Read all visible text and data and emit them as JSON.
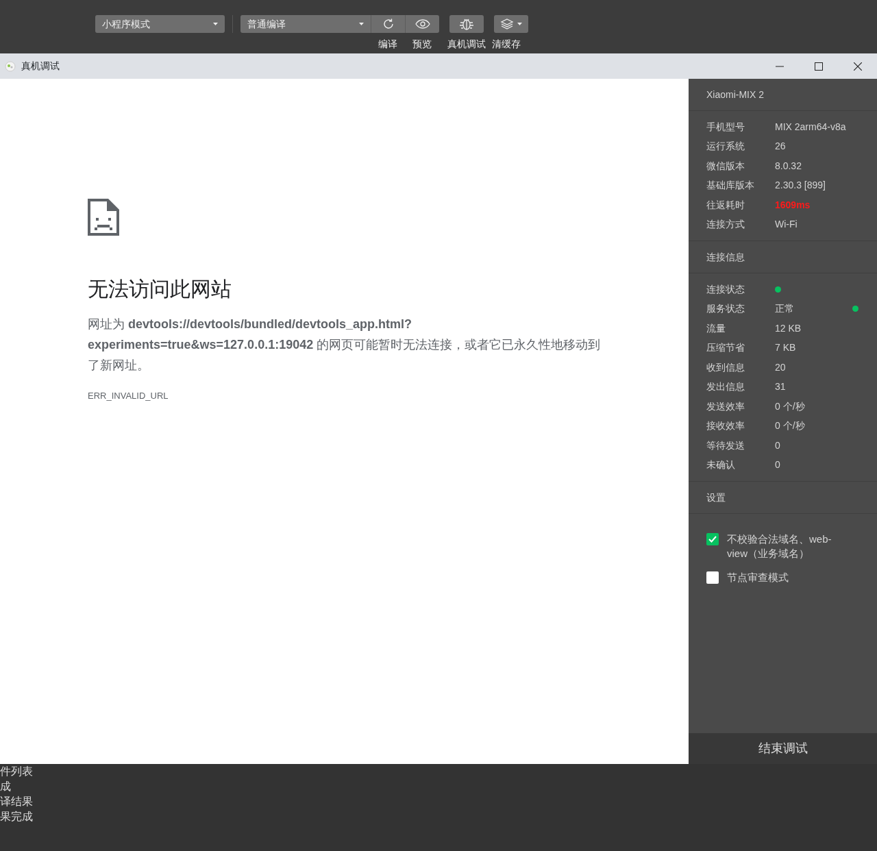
{
  "toolbar": {
    "mode_select": {
      "value": "小程序模式"
    },
    "compile_select": {
      "value": "普通编译"
    },
    "buttons": [
      {
        "kind": "refresh",
        "label": "编译"
      },
      {
        "kind": "preview",
        "label": "预览"
      },
      {
        "kind": "debug",
        "label": "真机调试"
      },
      {
        "kind": "cache",
        "label": "清缓存"
      }
    ]
  },
  "window": {
    "title": "真机调试"
  },
  "error_page": {
    "heading": "无法访问此网站",
    "message": "网址为 **devtools://devtools/bundled/devtools_app.html?experiments=true&ws=127.0.0.1:19042** 的网页可能暂时无法连接，或者它已永久性地移动到了新网址。",
    "error_code": "ERR_INVALID_URL"
  },
  "panel": {
    "device_name": "Xiaomi-MIX 2",
    "device_info": [
      {
        "label": "手机型号",
        "value": "MIX 2arm64-v8a",
        "warning": false
      },
      {
        "label": "运行系统",
        "value": "26",
        "warning": false
      },
      {
        "label": "微信版本",
        "value": "8.0.32",
        "warning": false
      },
      {
        "label": "基础库版本",
        "value": "2.30.3 [899]",
        "warning": false
      },
      {
        "label": "往返耗时",
        "value": "1609ms",
        "warning": true
      },
      {
        "label": "连接方式",
        "value": "Wi-Fi",
        "warning": false
      }
    ],
    "connection_title": "连接信息",
    "connection_info": [
      {
        "kind": "dot",
        "label": "连接状态",
        "color": "#07c160"
      },
      {
        "kind": "text_dot",
        "label": "服务状态",
        "value": "正常",
        "color": "#07c160"
      },
      {
        "kind": "text",
        "label": "流量",
        "value": "12 KB"
      },
      {
        "kind": "text",
        "label": "压缩节省",
        "value": "7 KB"
      },
      {
        "kind": "text",
        "label": "收到信息",
        "value": "20"
      },
      {
        "kind": "text",
        "label": "发出信息",
        "value": "31"
      },
      {
        "kind": "text",
        "label": "发送效率",
        "value": "0 个/秒"
      },
      {
        "kind": "text",
        "label": "接收效率",
        "value": "0 个/秒"
      },
      {
        "kind": "text",
        "label": "等待发送",
        "value": "0"
      },
      {
        "kind": "text",
        "label": "未确认",
        "value": "0"
      }
    ],
    "settings_title": "设置",
    "settings": [
      {
        "label": "不校验合法域名、web-view（业务域名）",
        "checked": true
      },
      {
        "label": "节点审查模式",
        "checked": false
      }
    ],
    "end_button": "结束调试"
  },
  "log_lines": [
    "件列表",
    "成",
    "译结果",
    "果完成"
  ]
}
